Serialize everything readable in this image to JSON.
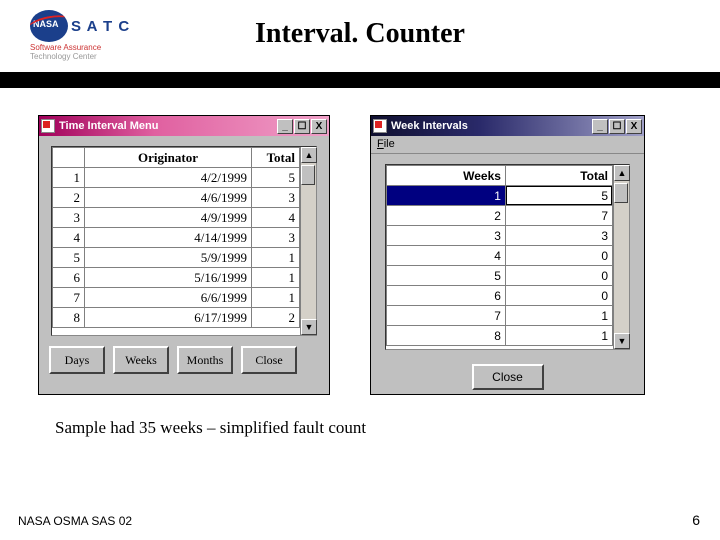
{
  "header": {
    "title": "Interval. Counter",
    "logo_satc": "S A T C",
    "logo_sub1": "Software Assurance",
    "logo_sub2": "Technology Center"
  },
  "left_window": {
    "title": "Time Interval Menu",
    "columns": {
      "originator": "Originator",
      "total": "Total"
    },
    "rows": [
      {
        "n": "1",
        "date": "4/2/1999",
        "total": "5"
      },
      {
        "n": "2",
        "date": "4/6/1999",
        "total": "3"
      },
      {
        "n": "3",
        "date": "4/9/1999",
        "total": "4"
      },
      {
        "n": "4",
        "date": "4/14/1999",
        "total": "3"
      },
      {
        "n": "5",
        "date": "5/9/1999",
        "total": "1"
      },
      {
        "n": "6",
        "date": "5/16/1999",
        "total": "1"
      },
      {
        "n": "7",
        "date": "6/6/1999",
        "total": "1"
      },
      {
        "n": "8",
        "date": "6/17/1999",
        "total": "2"
      }
    ],
    "buttons": {
      "days": "Days",
      "weeks": "Weeks",
      "months": "Months",
      "close": "Close"
    }
  },
  "right_window": {
    "title": "Week Intervals",
    "menu_file": "File",
    "columns": {
      "weeks": "Weeks",
      "total": "Total"
    },
    "rows": [
      {
        "weeks": "1",
        "total": "5"
      },
      {
        "weeks": "2",
        "total": "7"
      },
      {
        "weeks": "3",
        "total": "3"
      },
      {
        "weeks": "4",
        "total": "0"
      },
      {
        "weeks": "5",
        "total": "0"
      },
      {
        "weeks": "6",
        "total": "0"
      },
      {
        "weeks": "7",
        "total": "1"
      },
      {
        "weeks": "8",
        "total": "1"
      }
    ],
    "close": "Close"
  },
  "caption": "Sample had 35 weeks – simplified fault count",
  "footer": {
    "left": "NASA OSMA SAS 02",
    "page": "6"
  },
  "win_controls": {
    "min": "_",
    "max": "☐",
    "close": "X"
  }
}
